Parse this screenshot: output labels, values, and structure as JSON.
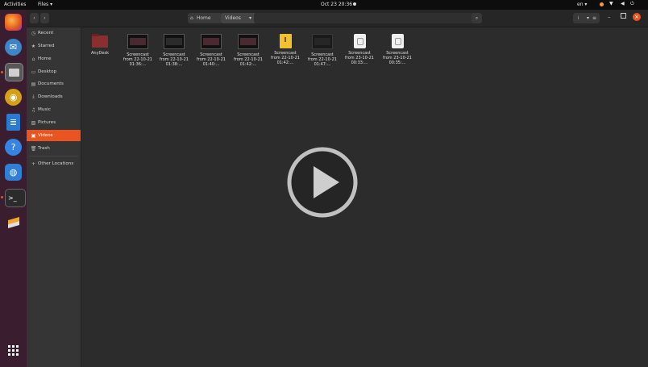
{
  "topbar": {
    "activities": "Activities",
    "app_menu": "Files ▾",
    "clock": "Oct 23  20:36",
    "lang": "en ▾"
  },
  "header": {
    "path": [
      "Home",
      "Videos"
    ]
  },
  "sidebar": {
    "items": [
      {
        "label": "Recent",
        "icon": "clock-icon"
      },
      {
        "label": "Starred",
        "icon": "star-icon"
      },
      {
        "label": "Home",
        "icon": "home-icon"
      },
      {
        "label": "Desktop",
        "icon": "desktop-icon"
      },
      {
        "label": "Documents",
        "icon": "document-icon"
      },
      {
        "label": "Downloads",
        "icon": "download-icon"
      },
      {
        "label": "Music",
        "icon": "music-icon"
      },
      {
        "label": "Pictures",
        "icon": "picture-icon"
      },
      {
        "label": "Videos",
        "icon": "video-icon"
      },
      {
        "label": "Trash",
        "icon": "trash-icon"
      },
      {
        "label": "Other Locations",
        "icon": "plus-icon"
      }
    ]
  },
  "files": [
    {
      "name": "AnyDesk",
      "kind": "folder"
    },
    {
      "name": "Screencast from 22-10-21 01:36:...",
      "kind": "video"
    },
    {
      "name": "Screencast from 22-10-21 01:38:...",
      "kind": "video"
    },
    {
      "name": "Screencast from 22-10-21 01:40:...",
      "kind": "video"
    },
    {
      "name": "Screencast from 22-10-21 01:42:...",
      "kind": "video"
    },
    {
      "name": "Screencast from 22-10-21 01:42:...",
      "kind": "yellow"
    },
    {
      "name": "Screencast from 22-10-21 01:47:...",
      "kind": "video-dark"
    },
    {
      "name": "Screencast from 23-10-21 00:33:...",
      "kind": "white"
    },
    {
      "name": "Screencast from 23-10-21 00:35:...",
      "kind": "white"
    }
  ],
  "colors": {
    "accent": "#e95420",
    "dock": "#3a1d2f"
  }
}
